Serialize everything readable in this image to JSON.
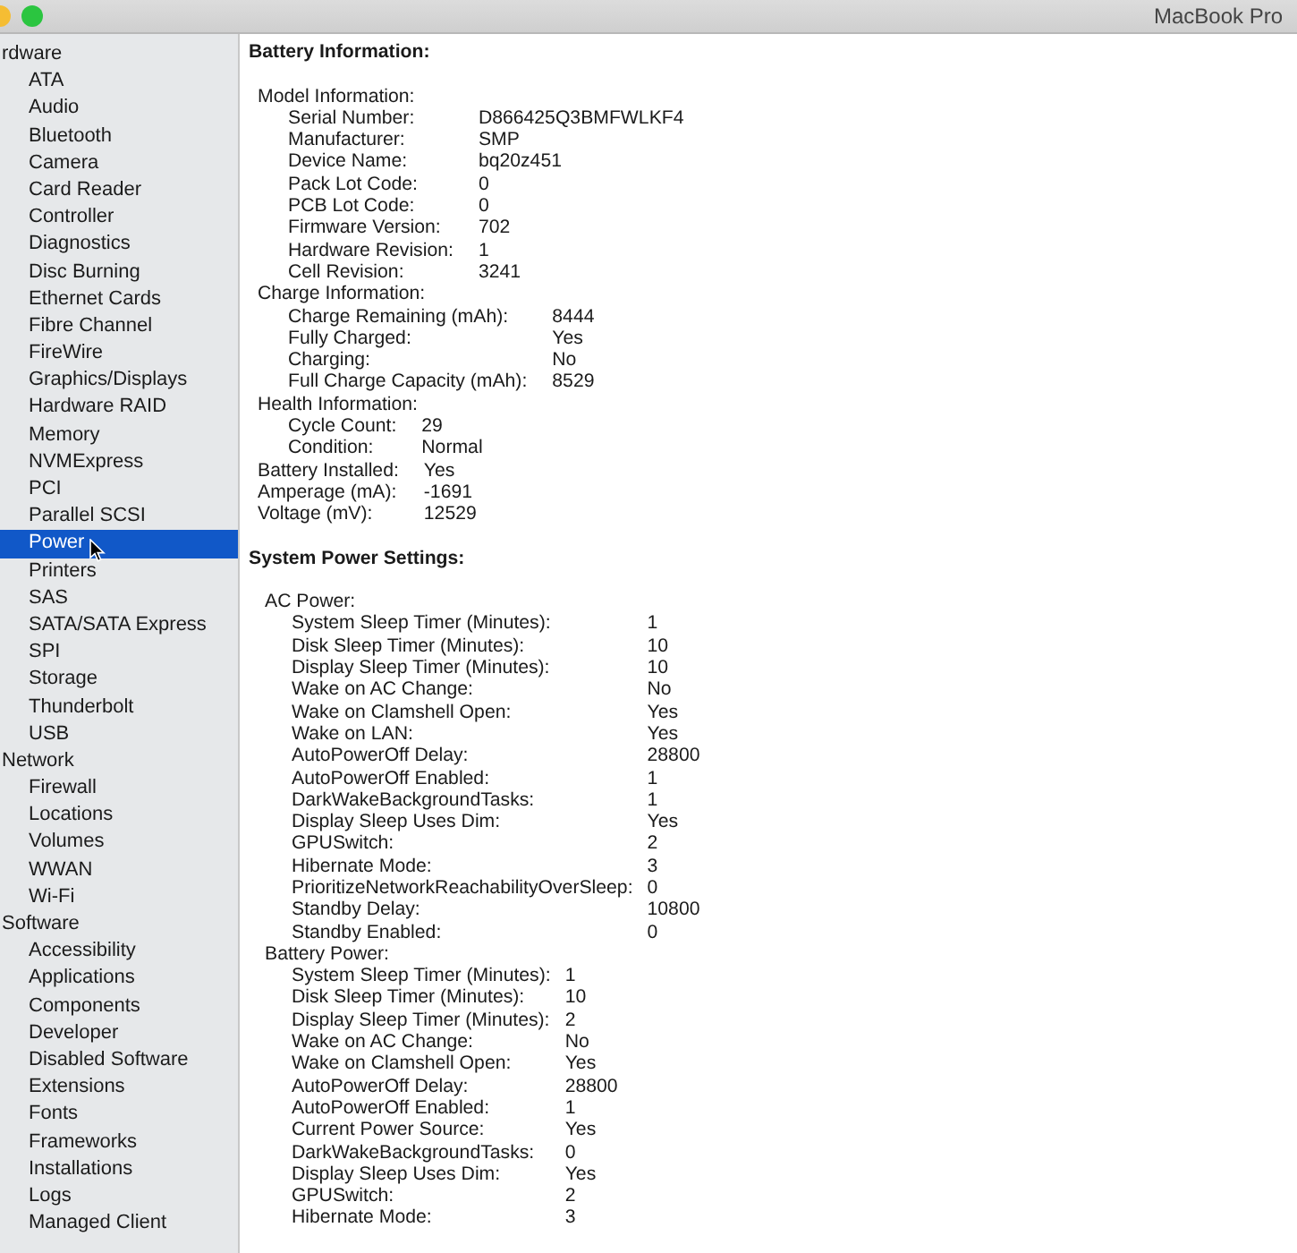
{
  "window": {
    "title": "MacBook Pro"
  },
  "sidebar": {
    "items": [
      {
        "label": "rdware",
        "selected": false,
        "children": [
          {
            "label": "ATA",
            "selected": false
          },
          {
            "label": "Audio",
            "selected": false
          },
          {
            "label": "Bluetooth",
            "selected": false
          },
          {
            "label": "Camera",
            "selected": false
          },
          {
            "label": "Card Reader",
            "selected": false
          },
          {
            "label": "Controller",
            "selected": false
          },
          {
            "label": "Diagnostics",
            "selected": false
          },
          {
            "label": "Disc Burning",
            "selected": false
          },
          {
            "label": "Ethernet Cards",
            "selected": false
          },
          {
            "label": "Fibre Channel",
            "selected": false
          },
          {
            "label": "FireWire",
            "selected": false
          },
          {
            "label": "Graphics/Displays",
            "selected": false
          },
          {
            "label": "Hardware RAID",
            "selected": false
          },
          {
            "label": "Memory",
            "selected": false
          },
          {
            "label": "NVMExpress",
            "selected": false
          },
          {
            "label": "PCI",
            "selected": false
          },
          {
            "label": "Parallel SCSI",
            "selected": false
          },
          {
            "label": "Power",
            "selected": true
          },
          {
            "label": "Printers",
            "selected": false
          },
          {
            "label": "SAS",
            "selected": false
          },
          {
            "label": "SATA/SATA Express",
            "selected": false
          },
          {
            "label": "SPI",
            "selected": false
          },
          {
            "label": "Storage",
            "selected": false
          },
          {
            "label": "Thunderbolt",
            "selected": false
          },
          {
            "label": "USB",
            "selected": false
          }
        ]
      },
      {
        "label": "Network",
        "selected": false,
        "children": [
          {
            "label": "Firewall",
            "selected": false
          },
          {
            "label": "Locations",
            "selected": false
          },
          {
            "label": "Volumes",
            "selected": false
          },
          {
            "label": "WWAN",
            "selected": false
          },
          {
            "label": "Wi-Fi",
            "selected": false
          }
        ]
      },
      {
        "label": "Software",
        "selected": false,
        "children": [
          {
            "label": "Accessibility",
            "selected": false
          },
          {
            "label": "Applications",
            "selected": false
          },
          {
            "label": "Components",
            "selected": false
          },
          {
            "label": "Developer",
            "selected": false
          },
          {
            "label": "Disabled Software",
            "selected": false
          },
          {
            "label": "Extensions",
            "selected": false
          },
          {
            "label": "Fonts",
            "selected": false
          },
          {
            "label": "Frameworks",
            "selected": false
          },
          {
            "label": "Installations",
            "selected": false
          },
          {
            "label": "Logs",
            "selected": false
          },
          {
            "label": "Managed Client",
            "selected": false
          }
        ]
      }
    ]
  },
  "content": {
    "sections": [
      {
        "title": "Battery Information:",
        "blocks": [
          {
            "kind": "group",
            "label": "Model Information:",
            "rows": [
              {
                "label": "Serial Number:",
                "value": "D866425Q3BMFWLKF4"
              },
              {
                "label": "Manufacturer:",
                "value": "SMP"
              },
              {
                "label": "Device Name:",
                "value": "bq20z451"
              },
              {
                "label": "Pack Lot Code:",
                "value": "0"
              },
              {
                "label": "PCB Lot Code:",
                "value": "0"
              },
              {
                "label": "Firmware Version:",
                "value": "702"
              },
              {
                "label": "Hardware Revision:",
                "value": "1"
              },
              {
                "label": "Cell Revision:",
                "value": "3241"
              }
            ]
          },
          {
            "kind": "group",
            "label": "Charge Information:",
            "rows": [
              {
                "label": "Charge Remaining (mAh):",
                "value": "8444"
              },
              {
                "label": "Fully Charged:",
                "value": "Yes"
              },
              {
                "label": "Charging:",
                "value": "No"
              },
              {
                "label": "Full Charge Capacity (mAh):",
                "value": "8529"
              }
            ]
          },
          {
            "kind": "group",
            "label": "Health Information:",
            "rows": [
              {
                "label": "Cycle Count:",
                "value": "29"
              },
              {
                "label": "Condition:",
                "value": "Normal"
              }
            ]
          },
          {
            "kind": "rows",
            "rows": [
              {
                "label": "Battery Installed:",
                "value": "Yes"
              },
              {
                "label": "Amperage (mA):",
                "value": "-1691"
              },
              {
                "label": "Voltage (mV):",
                "value": "12529"
              }
            ]
          }
        ]
      },
      {
        "title": "System Power Settings:",
        "blocks": [
          {
            "kind": "group",
            "label": "AC Power:",
            "rows": [
              {
                "label": "System Sleep Timer (Minutes):",
                "value": "1"
              },
              {
                "label": "Disk Sleep Timer (Minutes):",
                "value": "10"
              },
              {
                "label": "Display Sleep Timer (Minutes):",
                "value": "10"
              },
              {
                "label": "Wake on AC Change:",
                "value": "No"
              },
              {
                "label": "Wake on Clamshell Open:",
                "value": "Yes"
              },
              {
                "label": "Wake on LAN:",
                "value": "Yes"
              },
              {
                "label": "AutoPowerOff Delay:",
                "value": "28800"
              },
              {
                "label": "AutoPowerOff Enabled:",
                "value": "1"
              },
              {
                "label": "DarkWakeBackgroundTasks:",
                "value": "1"
              },
              {
                "label": "Display Sleep Uses Dim:",
                "value": "Yes"
              },
              {
                "label": "GPUSwitch:",
                "value": "2"
              },
              {
                "label": "Hibernate Mode:",
                "value": "3"
              },
              {
                "label": "PrioritizeNetworkReachabilityOverSleep:",
                "value": "0"
              },
              {
                "label": "Standby Delay:",
                "value": "10800"
              },
              {
                "label": "Standby Enabled:",
                "value": "0"
              }
            ]
          },
          {
            "kind": "group",
            "label": "Battery Power:",
            "rows": [
              {
                "label": "System Sleep Timer (Minutes):",
                "value": "1"
              },
              {
                "label": "Disk Sleep Timer (Minutes):",
                "value": "10"
              },
              {
                "label": "Display Sleep Timer (Minutes):",
                "value": "2"
              },
              {
                "label": "Wake on AC Change:",
                "value": "No"
              },
              {
                "label": "Wake on Clamshell Open:",
                "value": "Yes"
              },
              {
                "label": "AutoPowerOff Delay:",
                "value": "28800"
              },
              {
                "label": "AutoPowerOff Enabled:",
                "value": "1"
              },
              {
                "label": "Current Power Source:",
                "value": "Yes"
              },
              {
                "label": "DarkWakeBackgroundTasks:",
                "value": "0"
              },
              {
                "label": "Display Sleep Uses Dim:",
                "value": "Yes"
              },
              {
                "label": "GPUSwitch:",
                "value": "2"
              },
              {
                "label": "Hibernate Mode:",
                "value": "3"
              }
            ]
          }
        ]
      }
    ]
  }
}
